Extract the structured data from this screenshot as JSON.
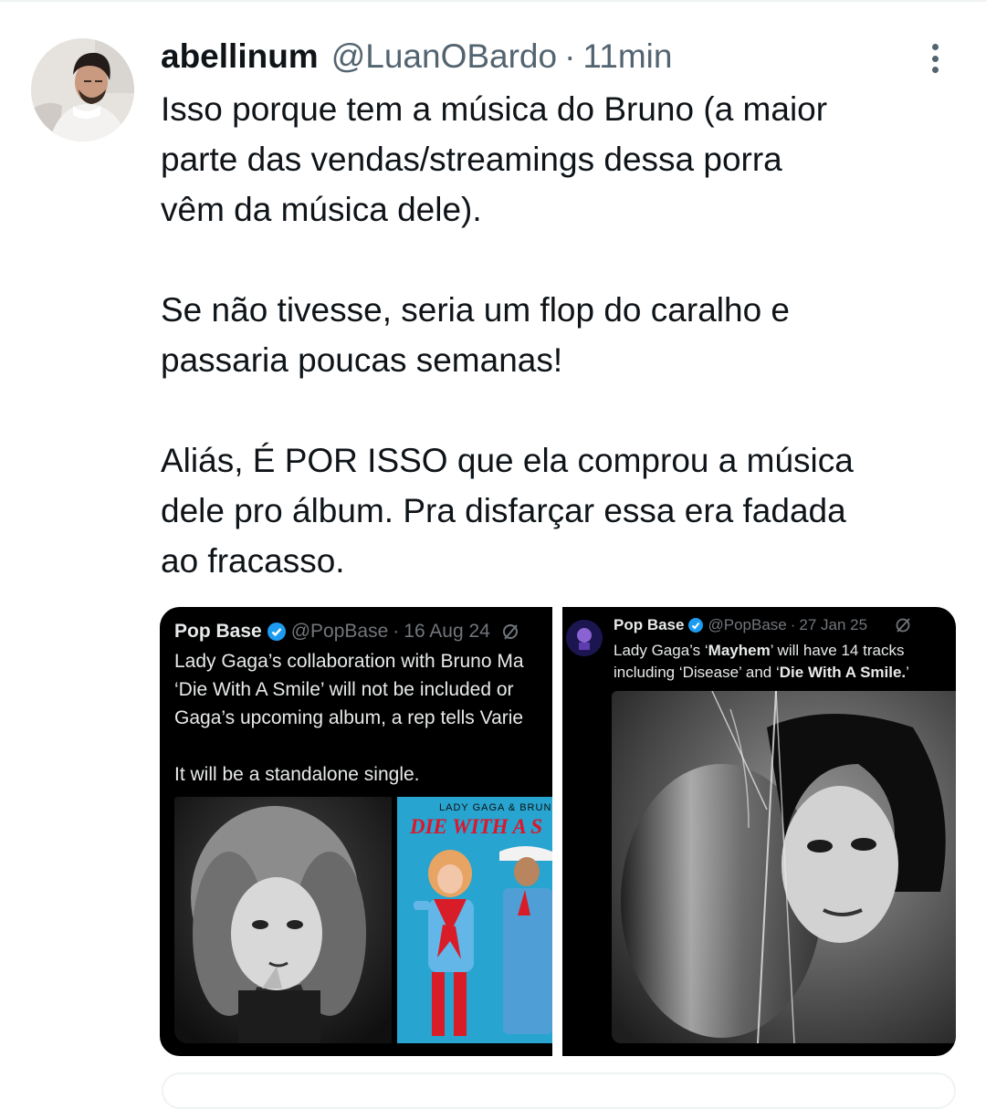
{
  "tweet": {
    "display_name": "abellinum",
    "handle": "@LuanOBardo",
    "separator": "·",
    "time": "11min",
    "text": "Isso porque tem a música do Bruno (a maior\nparte das vendas/streamings dessa porra\nvêm da música dele).\n\nSe não tivesse, seria um flop do caralho e\npassaria poucas semanas!\n\nAliás, É POR ISSO que ela comprou a música\ndele pro álbum. Pra disfarçar essa era fadada\nao fracasso."
  },
  "media": {
    "left_quote": {
      "name": "Pop Base",
      "handle": "@PopBase",
      "separator": "·",
      "date": "16 Aug 24",
      "text": "Lady Gaga’s collaboration with Bruno Ma\n‘Die With A Smile’ will not be included or\nGaga’s upcoming album, a rep tells Varie\n\nIt will be a standalone single.",
      "cover_title": "DIE WITH A S",
      "cover_artists": "LADY GAGA & BRUNO M"
    },
    "right_quote": {
      "name": "Pop Base",
      "handle": "@PopBase",
      "separator": "·",
      "date": "27 Jan 25",
      "line1_a": "Lady Gaga’s ‘",
      "line1_b": "Mayhem",
      "line1_c": "’ will have 14 tracks",
      "line2_a": "including ‘Disease’ and ‘",
      "line2_b": "Die With A Smile.",
      "line2_c": "’"
    }
  },
  "icons": {
    "more": "more-vertical-icon",
    "verified": "verified-badge-icon",
    "grok": "grok-icon"
  },
  "colors": {
    "text": "#0f1419",
    "secondary": "#536471",
    "verified": "#1d9bf0",
    "quote_bg": "#000000"
  }
}
